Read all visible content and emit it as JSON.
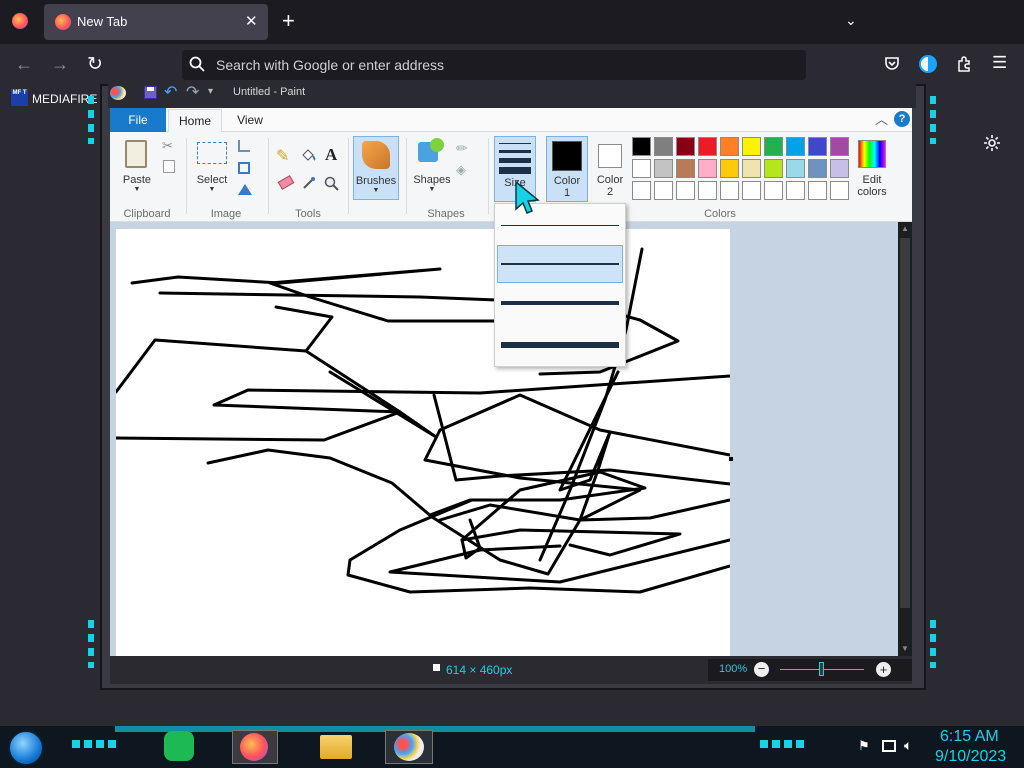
{
  "browser": {
    "tab_title": "New Tab",
    "url_placeholder": "Search with Google or enter address",
    "bookmark_label": "MEDIAFIRE",
    "bookmark_icon_text": "MF T"
  },
  "paint": {
    "title": "Untitled - Paint",
    "tabs": {
      "file": "File",
      "home": "Home",
      "view": "View"
    },
    "groups": {
      "clipboard": "Clipboard",
      "image": "Image",
      "tools": "Tools",
      "shapes": "Shapes",
      "colors": "Colors"
    },
    "buttons": {
      "paste": "Paste",
      "select": "Select",
      "brushes": "Brushes",
      "shapes": "Shapes",
      "size": "Size",
      "color1": "Color",
      "color1_num": "1",
      "color2": "Color",
      "color2_num": "2",
      "edit_colors_1": "Edit",
      "edit_colors_2": "colors",
      "text_tool": "A"
    },
    "palette_row1": [
      "#000000",
      "#7f7f7f",
      "#880015",
      "#ed1c24",
      "#ff7f27",
      "#fff200",
      "#22b14c",
      "#00a2e8",
      "#3f48cc",
      "#a349a4"
    ],
    "palette_row2": [
      "#ffffff",
      "#c3c3c3",
      "#b97a57",
      "#ffaec9",
      "#ffc90e",
      "#efe4b0",
      "#b5e61d",
      "#99d9ea",
      "#7092be",
      "#c8bfe7"
    ],
    "palette_row3": [
      "#ffffff",
      "#ffffff",
      "#ffffff",
      "#ffffff",
      "#ffffff",
      "#ffffff",
      "#ffffff",
      "#ffffff",
      "#ffffff",
      "#ffffff"
    ],
    "status": {
      "dimensions": "614 × 460px",
      "zoom": "100%"
    }
  },
  "taskbar": {
    "time": "6:15 AM",
    "date": "9/10/2023"
  }
}
